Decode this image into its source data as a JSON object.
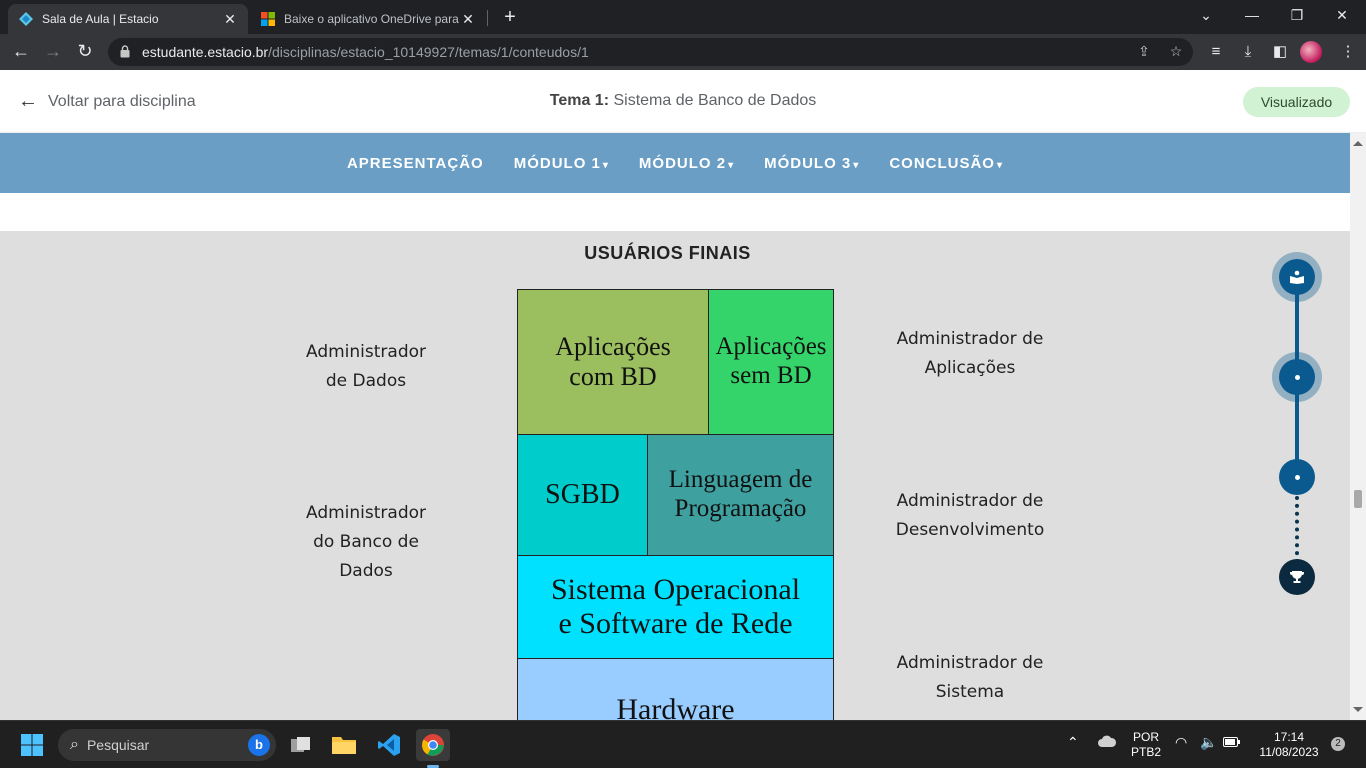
{
  "browser": {
    "tabs": [
      {
        "title": "Sala de Aula | Estacio",
        "active": true
      },
      {
        "title": "Baixe o aplicativo OneDrive para",
        "active": false
      }
    ],
    "url_host": "estudante.estacio.br",
    "url_path": "/disciplinas/estacio_10149927/temas/1/conteudos/1",
    "new_tab": "+",
    "minimize": "⌄",
    "win_min": "—",
    "win_restore": "❐",
    "win_close": "✕"
  },
  "header": {
    "back_label": "Voltar para disciplina",
    "tema_prefix": "Tema 1:",
    "tema_title": "Sistema de Banco de Dados",
    "status_badge": "Visualizado"
  },
  "menu": {
    "items": [
      {
        "label": "APRESENTAÇÃO",
        "dropdown": false
      },
      {
        "label": "MÓDULO 1",
        "dropdown": true
      },
      {
        "label": "MÓDULO 2",
        "dropdown": true
      },
      {
        "label": "MÓDULO 3",
        "dropdown": true
      },
      {
        "label": "CONCLUSÃO",
        "dropdown": true
      }
    ]
  },
  "diagram": {
    "top_label": "USUÁRIOS FINAIS",
    "left_labels": [
      "Administrador\nde Dados",
      "Administrador\ndo Banco de\nDados"
    ],
    "right_labels": [
      "Administrador de\nAplicações",
      "Administrador de\nDesenvolvimento",
      "Administrador de\nSistema"
    ],
    "blocks": {
      "apps_com_bd": "Aplicações\ncom BD",
      "apps_sem_bd": "Aplicações\nsem BD",
      "sgbd": "SGBD",
      "linguagem": "Linguagem de\nProgramação",
      "sistema_op": "Sistema Operacional\ne Software de Rede",
      "hardware": "Hardware"
    },
    "colors": {
      "apps_com_bd": "#9bbe5e",
      "apps_sem_bd": "#35d46a",
      "sgbd": "#00cccc",
      "linguagem": "#3fa0a0",
      "sistema_op": "#00e1ff",
      "hardware": "#99ccff"
    }
  },
  "timeline": {
    "steps": [
      {
        "icon": "book-icon"
      },
      {
        "icon": "dot-icon"
      },
      {
        "icon": "dot-icon"
      },
      {
        "icon": "trophy-icon"
      }
    ]
  },
  "taskbar": {
    "search_placeholder": "Pesquisar",
    "lang_top": "POR",
    "lang_bottom": "PTB2",
    "time": "17:14",
    "date": "11/08/2023",
    "notifications": "2"
  }
}
